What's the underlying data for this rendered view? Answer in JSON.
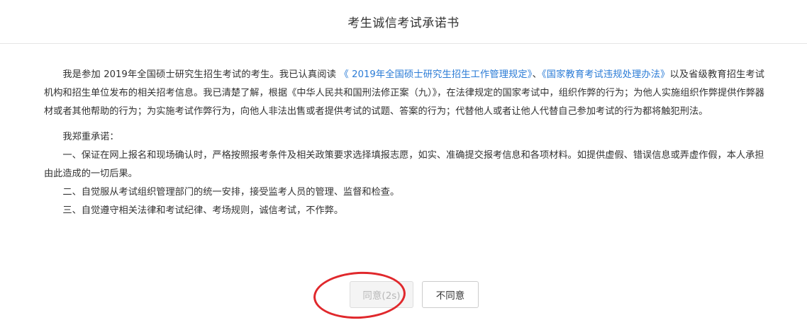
{
  "dialog": {
    "title": "考生诚信考试承诺书"
  },
  "body": {
    "intro_part1": "我是参加 2019年全国硕士研究生招生考试的考生。我已认真阅读 ",
    "link_regulation": "《 2019年全国硕士研究生招生工作管理规定》",
    "intro_sep": "、",
    "link_violation": "《国家教育考试违规处理办法》",
    "intro_part2": "以及省级教育招生考试机构和招生单位发布的相关招考信息。我已清楚了解，根据《中华人民共和国刑法修正案（九）》，在法律规定的国家考试中，组织作弊的行为；为他人实施组织作弊提供作弊器材或者其他帮助的行为；为实施考试作弊行为，向他人非法出售或者提供考试的试题、答案的行为；代替他人或者让他人代替自己参加考试的行为都将触犯刑法。",
    "pledge_heading": "我郑重承诺：",
    "clauses": [
      "一、保证在网上报名和现场确认时，严格按照报考条件及相关政策要求选择填报志愿，如实、准确提交报考信息和各项材料。如提供虚假、错误信息或弄虚作假，本人承担由此造成的一切后果。",
      "二、自觉服从考试组织管理部门的统一安排，接受监考人员的管理、监督和检查。",
      "三、自觉遵守相关法律和考试纪律、考场规则，诚信考试，不作弊。"
    ]
  },
  "footer": {
    "agree_label": "同意(2s)",
    "disagree_label": "不同意"
  },
  "colors": {
    "link": "#2a7bd6",
    "highlight_ring": "#e0282c",
    "disabled_text": "#b8b8b8"
  }
}
